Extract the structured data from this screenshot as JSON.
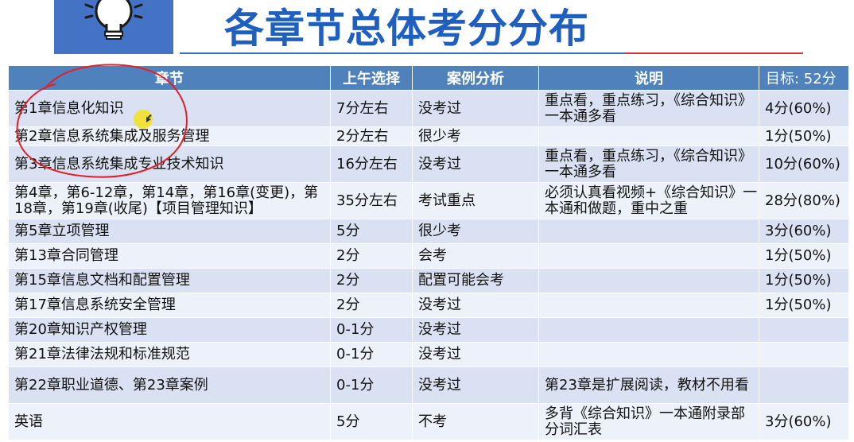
{
  "slide": {
    "title": "各章节总体考分分布"
  },
  "colors": {
    "header_bg": "#4f81bd",
    "row_odd": "#d9e1f2",
    "row_even": "#edf1f9",
    "title": "#1f5fbf",
    "annotation": "#e0202a"
  },
  "table": {
    "headers": [
      "章节",
      "上午选择",
      "案例分析",
      "说明",
      "目标: 52分"
    ],
    "rows": [
      {
        "chapter": "第1章信息化知识",
        "morning": "7分左右",
        "case": "没考过",
        "note": "重点看，重点练习，《综合知识》一本通多看",
        "goal": "4分(60%)"
      },
      {
        "chapter": "第2章信息系统集成及服务管理",
        "morning": "2分左右",
        "case": "很少考",
        "note": "",
        "goal": "1分(50%)"
      },
      {
        "chapter": "第3章信息系统集成专业技术知识",
        "morning": "16分左右",
        "case": "没考过",
        "note": "重点看，重点练习，《综合知识》一本通多看",
        "goal": "10分(60%)"
      },
      {
        "chapter": "第4章，第6-12章，第14章，第16章(变更)，第18章，第19章(收尾)【项目管理知识】",
        "morning": "35分左右",
        "case": "考试重点",
        "note": "必须认真看视频+《综合知识》一本通和做题，重中之重",
        "goal": "28分(80%)"
      },
      {
        "chapter": "第5章立项管理",
        "morning": "5分",
        "case": "很少考",
        "note": "",
        "goal": "3分(60%)"
      },
      {
        "chapter": "第13章合同管理",
        "morning": "2分",
        "case": "会考",
        "note": "",
        "goal": "1分(50%)"
      },
      {
        "chapter": "第15章信息文档和配置管理",
        "morning": "2分",
        "case": "配置可能会考",
        "note": "",
        "goal": "1分(50%)"
      },
      {
        "chapter": "第17章信息系统安全管理",
        "morning": "2分",
        "case": "没考过",
        "note": "",
        "goal": "1分(50%)"
      },
      {
        "chapter": "第20章知识产权管理",
        "morning": "0-1分",
        "case": "没考过",
        "note": "",
        "goal": ""
      },
      {
        "chapter": "第21章法律法规和标准规范",
        "morning": "0-1分",
        "case": "没考过",
        "note": "",
        "goal": ""
      },
      {
        "chapter": "第22章职业道德、第23章案例",
        "morning": "0-1分",
        "case": "没考过",
        "note": "第23章是扩展阅读，教材不用看",
        "goal": ""
      },
      {
        "chapter": "英语",
        "morning": "5分",
        "case": "不考",
        "note": "多背《综合知识》一本通附录部分词汇表",
        "goal": "3分(60%)"
      }
    ]
  }
}
